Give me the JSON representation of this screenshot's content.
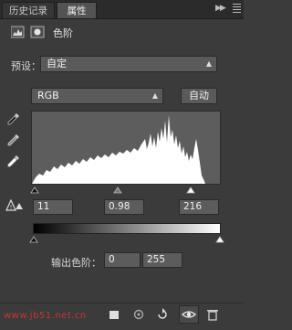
{
  "tabs": [
    {
      "label": "历史记录",
      "active": false
    },
    {
      "label": "属性",
      "active": true
    }
  ],
  "panel": {
    "title": "色阶",
    "preset_label": "预设：",
    "preset_value": "自定",
    "channel_value": "RGB",
    "auto_button": "自动",
    "input_levels": {
      "black": "11",
      "gamma": "0.98",
      "white": "216"
    },
    "output_label": "输出色阶：",
    "output_levels": {
      "black": "0",
      "white": "255"
    }
  },
  "watermark": "www.jb51.net.cn",
  "icons": {
    "tab_close": "close-icon",
    "menu": "panel-menu-icon",
    "adjustment": "levels-adjustment-icon",
    "mask": "mask-icon",
    "eyedropper_black": "eyedropper-black-icon",
    "eyedropper_gray": "eyedropper-gray-icon",
    "eyedropper_white": "eyedropper-white-icon",
    "clip_warning": "clip-warning-icon"
  },
  "colors": {
    "panel_bg": "#3b3b3b",
    "field_bg": "#5a5a5a",
    "histogram_bg": "#5d5d5d",
    "histogram_fill": "#ffffff"
  }
}
